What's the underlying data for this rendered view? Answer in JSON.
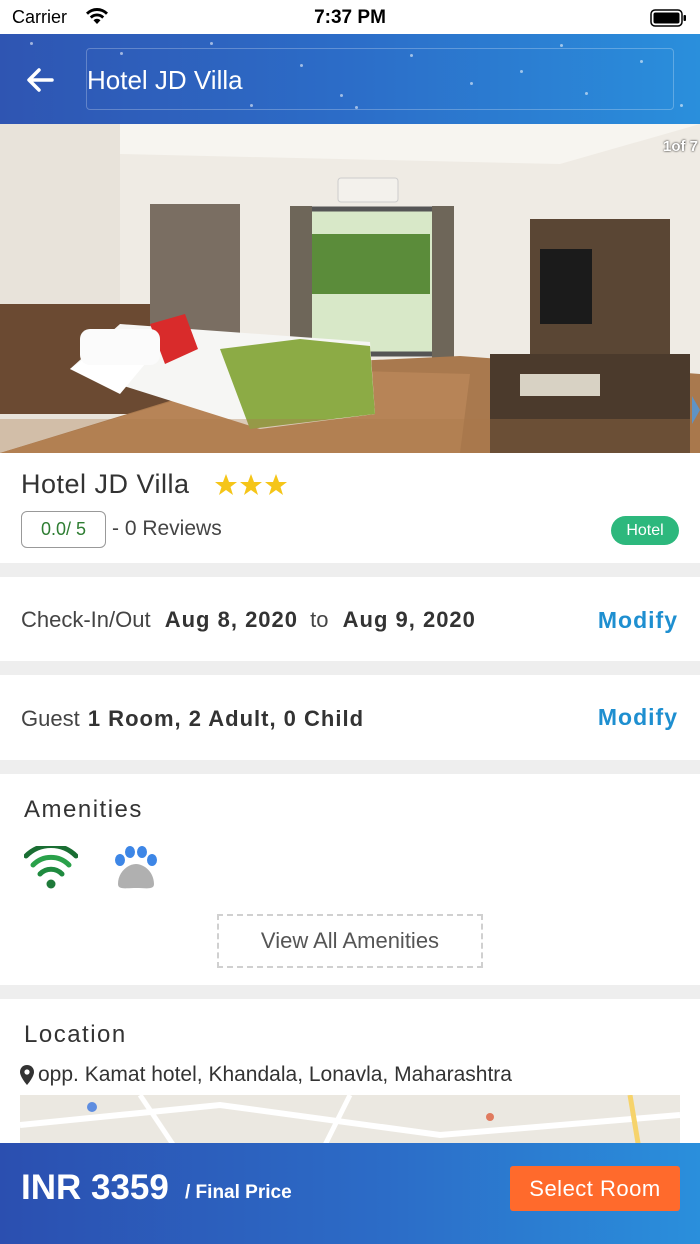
{
  "status_bar": {
    "carrier": "Carrier",
    "time": "7:37 PM"
  },
  "header": {
    "title": "Hotel JD Villa"
  },
  "gallery": {
    "counter": "1of 7"
  },
  "hotel": {
    "name": "Hotel JD Villa",
    "star_count": 3,
    "rating": "0.0/ 5",
    "reviews": "- 0 Reviews",
    "type": "Hotel"
  },
  "stay": {
    "label": "Check-In/Out",
    "check_in": "Aug 8, 2020",
    "connector": "to",
    "check_out": "Aug 9, 2020",
    "modify": "Modify"
  },
  "guest": {
    "label": "Guest",
    "value": "1 Room, 2 Adult, 0 Child",
    "modify": "Modify"
  },
  "amenities": {
    "title": "Amenities",
    "icons": [
      "wifi-icon",
      "pet-paw-icon"
    ],
    "view_all": "View All Amenities"
  },
  "location": {
    "title": "Location",
    "address": "opp. Kamat hotel, Khandala, Lonavla, Maharashtra"
  },
  "footer": {
    "price": "INR 3359",
    "price_suffix": "/ Final Price",
    "select_room": "Select Room"
  },
  "colors": {
    "header_gradient_start": "#2f55b2",
    "header_gradient_end": "#2a8fdc",
    "modify": "#1e8fd0",
    "badge": "#2db87d",
    "cta": "#ff6a2c",
    "star": "#f5c518"
  }
}
